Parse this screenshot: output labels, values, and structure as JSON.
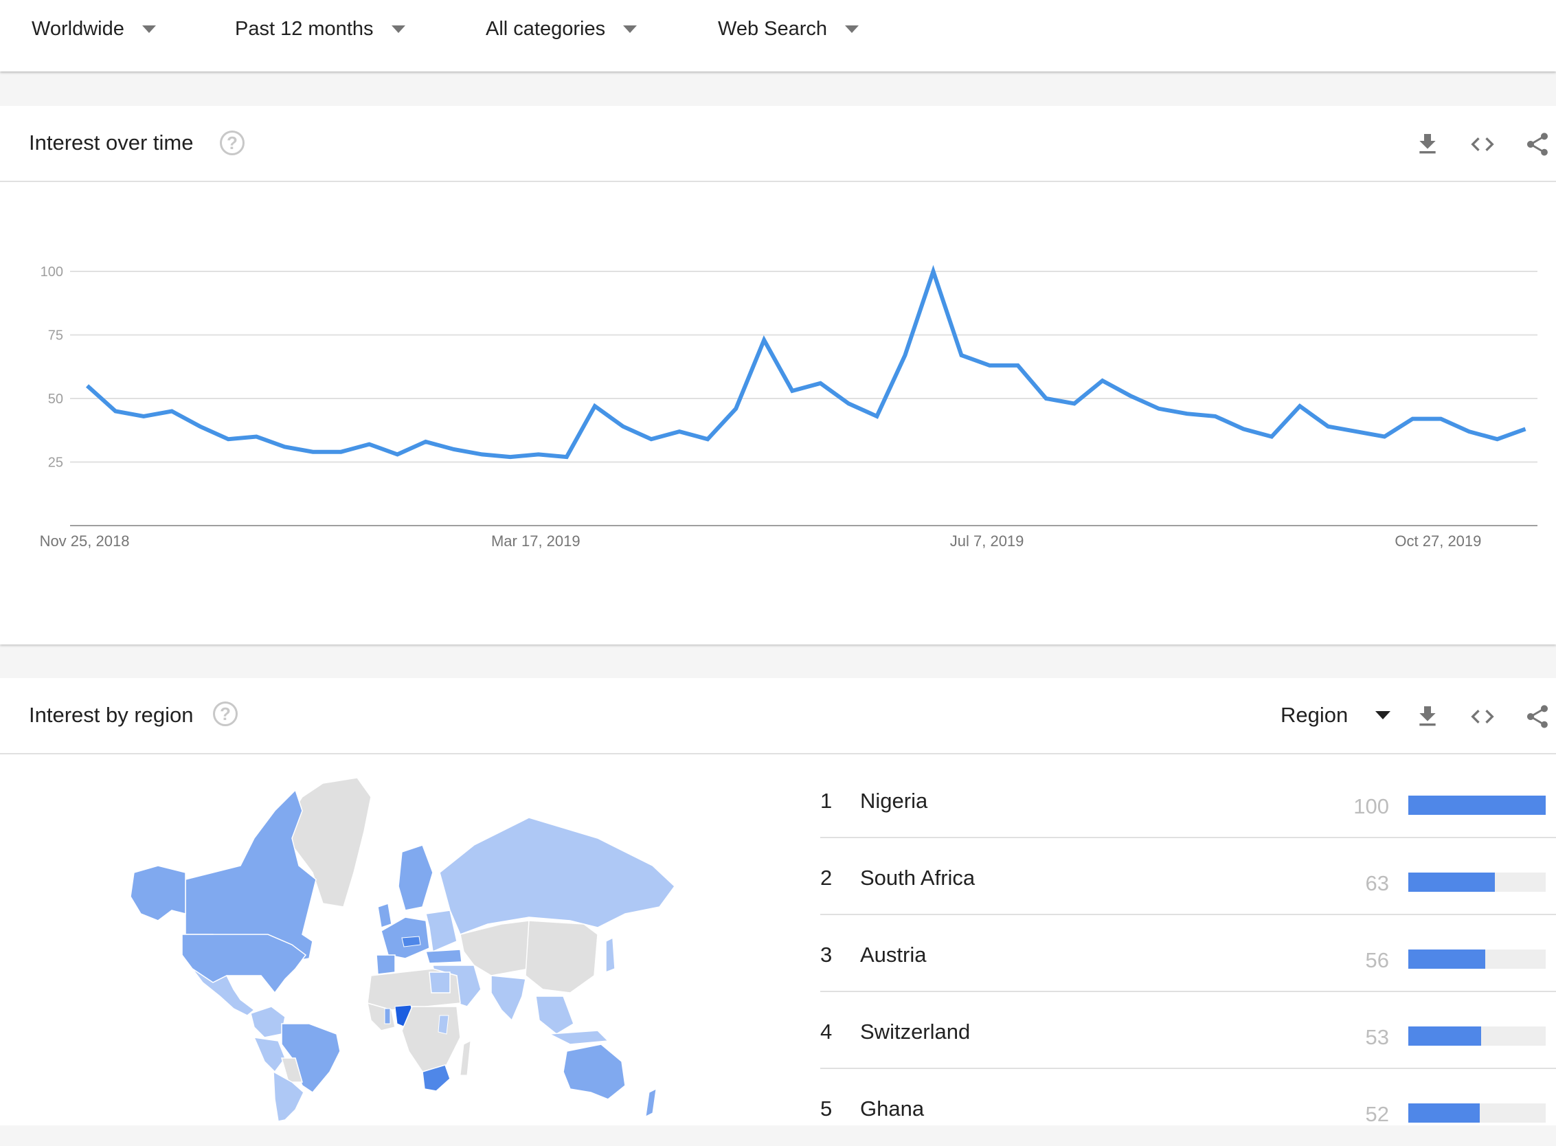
{
  "filters": [
    {
      "label": "Worldwide",
      "icon": "caret-down-icon"
    },
    {
      "label": "Past 12 months",
      "icon": "caret-down-icon"
    },
    {
      "label": "All categories",
      "icon": "caret-down-icon"
    },
    {
      "label": "Web Search",
      "icon": "caret-down-icon"
    }
  ],
  "interest_over_time": {
    "title": "Interest over time",
    "help_icon": "?",
    "actions": [
      "download-icon",
      "embed-code-icon",
      "share-icon"
    ]
  },
  "interest_by_region": {
    "title": "Interest by region",
    "help_icon": "?",
    "resolution_select": "Region",
    "actions": [
      "download-icon",
      "embed-code-icon",
      "share-icon"
    ],
    "map": {
      "colors": {
        "no_data": "#e0e0e0",
        "low": "#aec8f5",
        "mid": "#80a9ef",
        "high": "#4f87e8",
        "max": "#1c5ee0"
      }
    },
    "rankings": [
      {
        "rank": "1",
        "name": "Nigeria",
        "value": 100
      },
      {
        "rank": "2",
        "name": "South Africa",
        "value": 63
      },
      {
        "rank": "3",
        "name": "Austria",
        "value": 56
      },
      {
        "rank": "4",
        "name": "Switzerland",
        "value": 53
      },
      {
        "rank": "5",
        "name": "Ghana",
        "value": 52
      }
    ]
  },
  "colors": {
    "line": "#4593e6",
    "bar": "#4f87e8",
    "bar_track": "#eeeeee",
    "grid": "#e0e0e0",
    "axis": "#9e9e9e"
  },
  "chart_data": {
    "type": "line",
    "title": "Interest over time",
    "xlabel": "",
    "ylabel": "",
    "ylim": [
      0,
      100
    ],
    "yticks": [
      25,
      50,
      75,
      100
    ],
    "grid": true,
    "x_tick_labels": [
      {
        "label": "Nov 25, 2018",
        "index": 0
      },
      {
        "label": "Mar 17, 2019",
        "index": 16
      },
      {
        "label": "Jul 7, 2019",
        "index": 32
      },
      {
        "label": "Oct 27, 2019",
        "index": 48
      }
    ],
    "x_start": "Nov 25, 2018",
    "x_interval": "weekly",
    "series": [
      {
        "name": "Interest",
        "values": [
          55,
          45,
          43,
          45,
          39,
          34,
          35,
          31,
          29,
          29,
          32,
          28,
          33,
          30,
          28,
          27,
          28,
          27,
          47,
          39,
          34,
          37,
          34,
          46,
          73,
          53,
          56,
          48,
          43,
          67,
          100,
          67,
          63,
          63,
          50,
          48,
          57,
          51,
          46,
          44,
          43,
          38,
          35,
          47,
          39,
          37,
          35,
          42,
          42,
          37,
          34,
          38
        ]
      }
    ]
  }
}
